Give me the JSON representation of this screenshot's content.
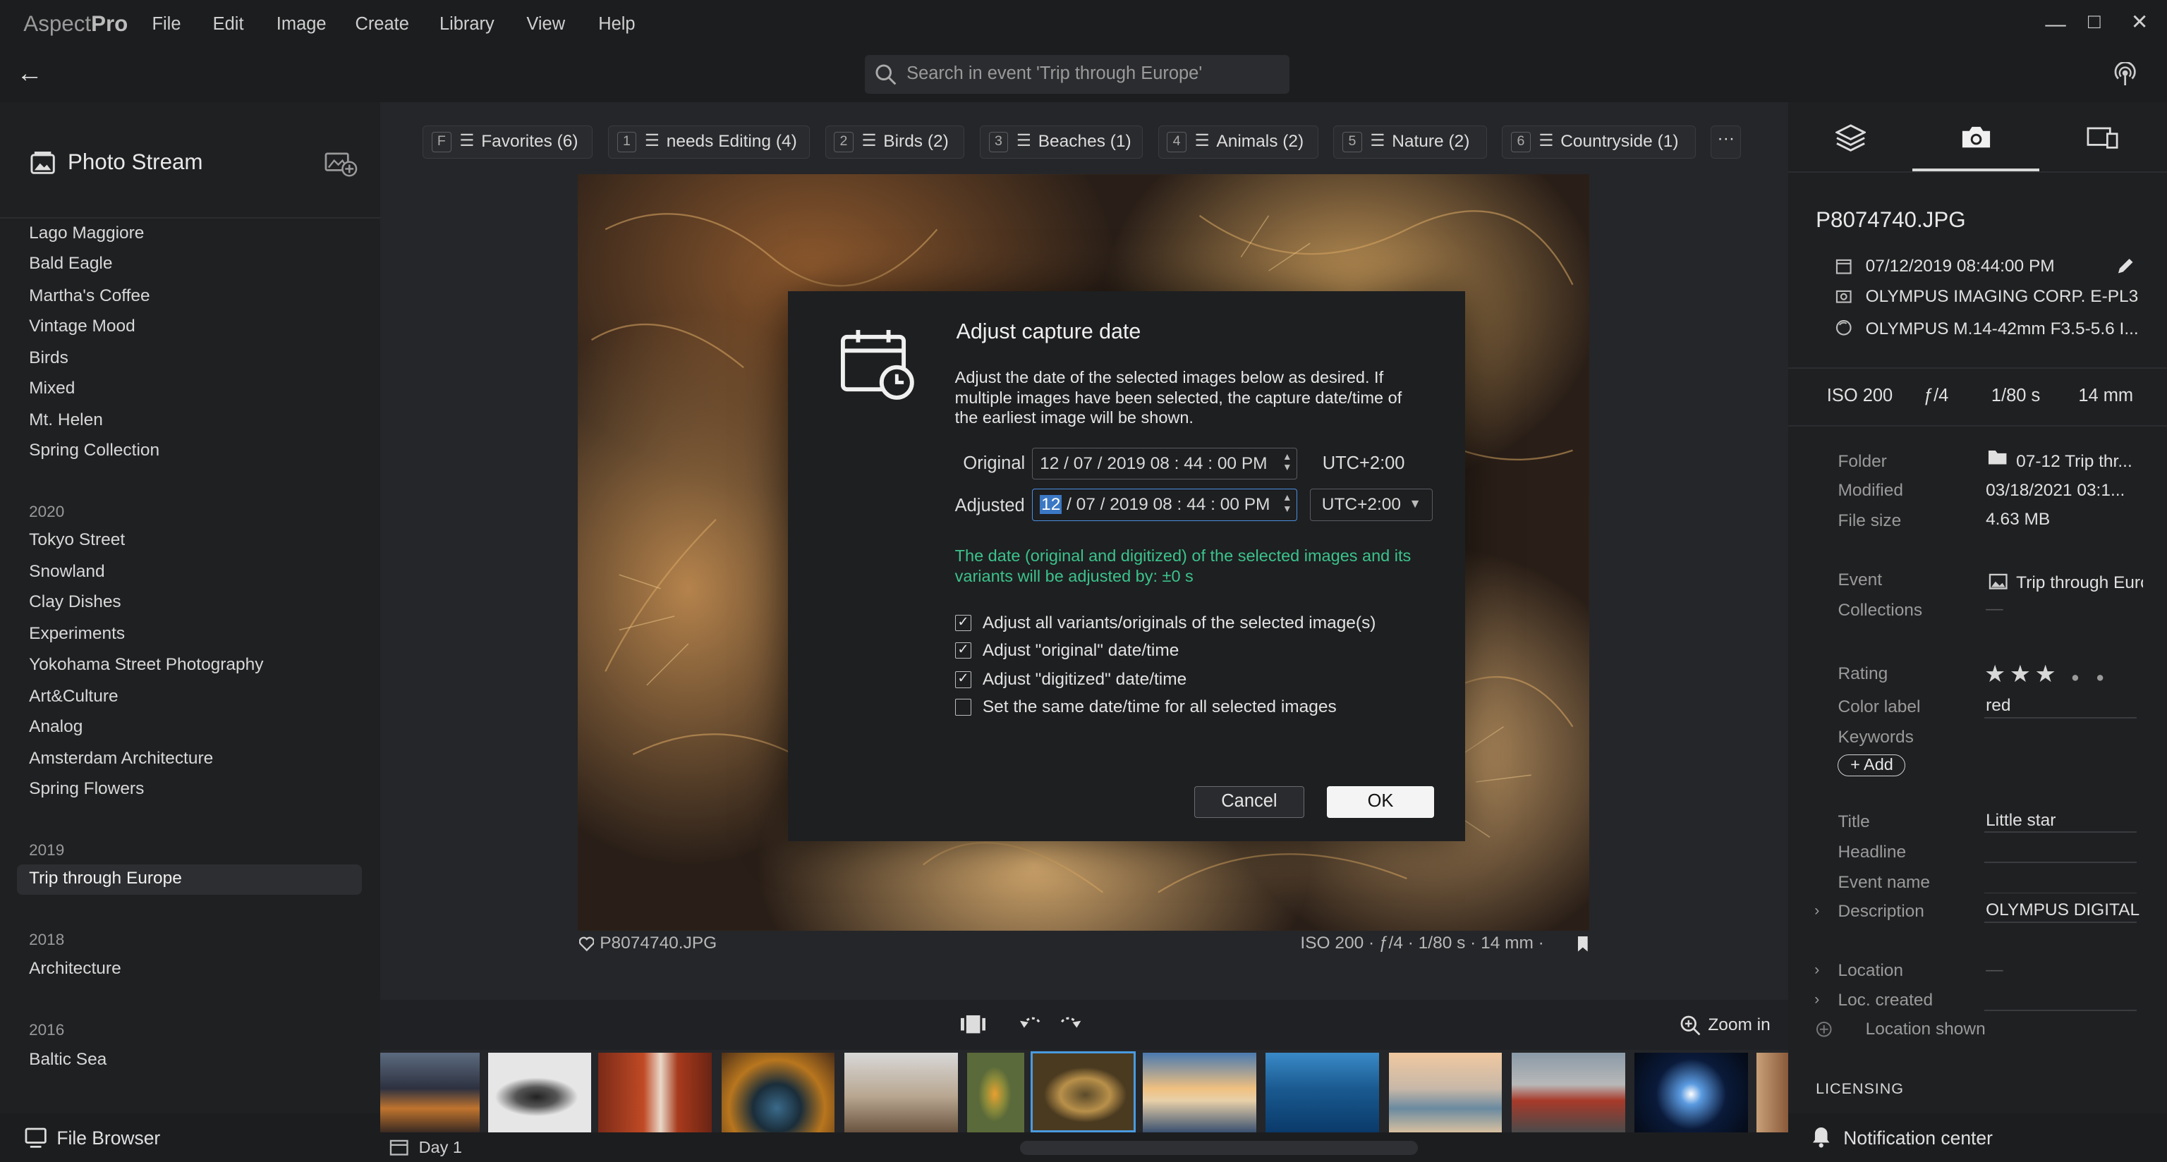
{
  "app": {
    "brand_a": "Aspect",
    "brand_b": "Pro"
  },
  "menu": [
    "File",
    "Edit",
    "Image",
    "Create",
    "Library",
    "View",
    "Help"
  ],
  "search": {
    "placeholder": "Search in event 'Trip through Europe'"
  },
  "sidebar": {
    "title": "Photo Stream",
    "items_top": [
      "Lago Maggiore",
      "Bald Eagle",
      "Martha's Coffee",
      "Vintage Mood",
      "Birds",
      "Mixed",
      "Mt. Helen",
      "Spring Collection"
    ],
    "year_2020": "2020",
    "items_2020": [
      "Tokyo Street",
      "Snowland",
      "Clay Dishes",
      "Experiments",
      "Yokohama Street Photography",
      "Art&Culture",
      "Analog",
      "Amsterdam Architecture",
      "Spring Flowers"
    ],
    "year_2019": "2019",
    "items_2019": [
      "Trip through Europe"
    ],
    "year_2018": "2018",
    "items_2018": [
      "Architecture"
    ],
    "year_2016": "2016",
    "items_2016": [
      "Baltic Sea"
    ],
    "footer": "File Browser"
  },
  "chips": [
    {
      "key": "F",
      "label": "Favorites (6)"
    },
    {
      "key": "1",
      "label": "needs Editing (4)"
    },
    {
      "key": "2",
      "label": "Birds (2)"
    },
    {
      "key": "3",
      "label": "Beaches (1)"
    },
    {
      "key": "4",
      "label": "Animals (2)"
    },
    {
      "key": "5",
      "label": "Nature (2)"
    },
    {
      "key": "6",
      "label": "Countryside (1)"
    }
  ],
  "photo": {
    "filename": "P8074740.JPG",
    "exif_line": "ISO 200  ·  ƒ/4  ·  1/80 s  ·  14 mm  ·"
  },
  "dialog": {
    "title": "Adjust capture date",
    "description": "Adjust the date of the selected images below as desired. If multiple images have been selected, the capture date/time of the earliest image will be shown.",
    "original_label": "Original",
    "original_value": "12 / 07 / 2019   08 : 44 : 00   PM",
    "original_tz": "UTC+2:00",
    "adjusted_label": "Adjusted",
    "adjusted_month": "12",
    "adjusted_rest": " / 07 / 2019   08 : 44 : 00   PM",
    "adjusted_tz": "UTC+2:00",
    "note": "The date (original and digitized) of the selected images and its variants will be adjusted by: ±0 s",
    "options": [
      {
        "label": "Adjust all variants/originals of the selected image(s)",
        "checked": true
      },
      {
        "label": "Adjust \"original\" date/time",
        "checked": true
      },
      {
        "label": "Adjust \"digitized\" date/time",
        "checked": true
      },
      {
        "label": "Set the same date/time for all selected images",
        "checked": false
      }
    ],
    "cancel": "Cancel",
    "ok": "OK"
  },
  "strip": {
    "zoom_label": "Zoom in",
    "day_label": "Day 1"
  },
  "right": {
    "filename": "P8074740.JPG",
    "date": "07/12/2019 08:44:00 PM",
    "camera": "OLYMPUS IMAGING CORP. E-PL3",
    "lens": "OLYMPUS M.14-42mm F3.5-5.6 I...",
    "iso": "ISO 200",
    "aperture": "ƒ/4",
    "shutter": "1/80 s",
    "focal": "14 mm",
    "folder_label": "Folder",
    "folder_value": "07-12 Trip thr...",
    "modified_label": "Modified",
    "modified_value": "03/18/2021 03:1...",
    "filesize_label": "File size",
    "filesize_value": "4.63 MB",
    "event_label": "Event",
    "event_value": "Trip through Euro",
    "collections_label": "Collections",
    "collections_value": "—",
    "rating_label": "Rating",
    "rating_stars": 3,
    "color_label": "Color label",
    "color_value": "red",
    "keywords_label": "Keywords",
    "add_label": "+ Add",
    "title_label": "Title",
    "title_value": "Little star",
    "headline_label": "Headline",
    "eventname_label": "Event name",
    "description_label": "Description",
    "description_value": "OLYMPUS DIGITAL",
    "location_label": "Location",
    "location_value": "—",
    "loccreated_label": "Loc. created",
    "locshown_label": "Location shown",
    "licensing": "LICENSING",
    "notification": "Notification center"
  },
  "colors": {
    "accent_green": "#3bc38c",
    "selection_blue": "#3b78c4",
    "thumb_border": "#4a9be0"
  }
}
